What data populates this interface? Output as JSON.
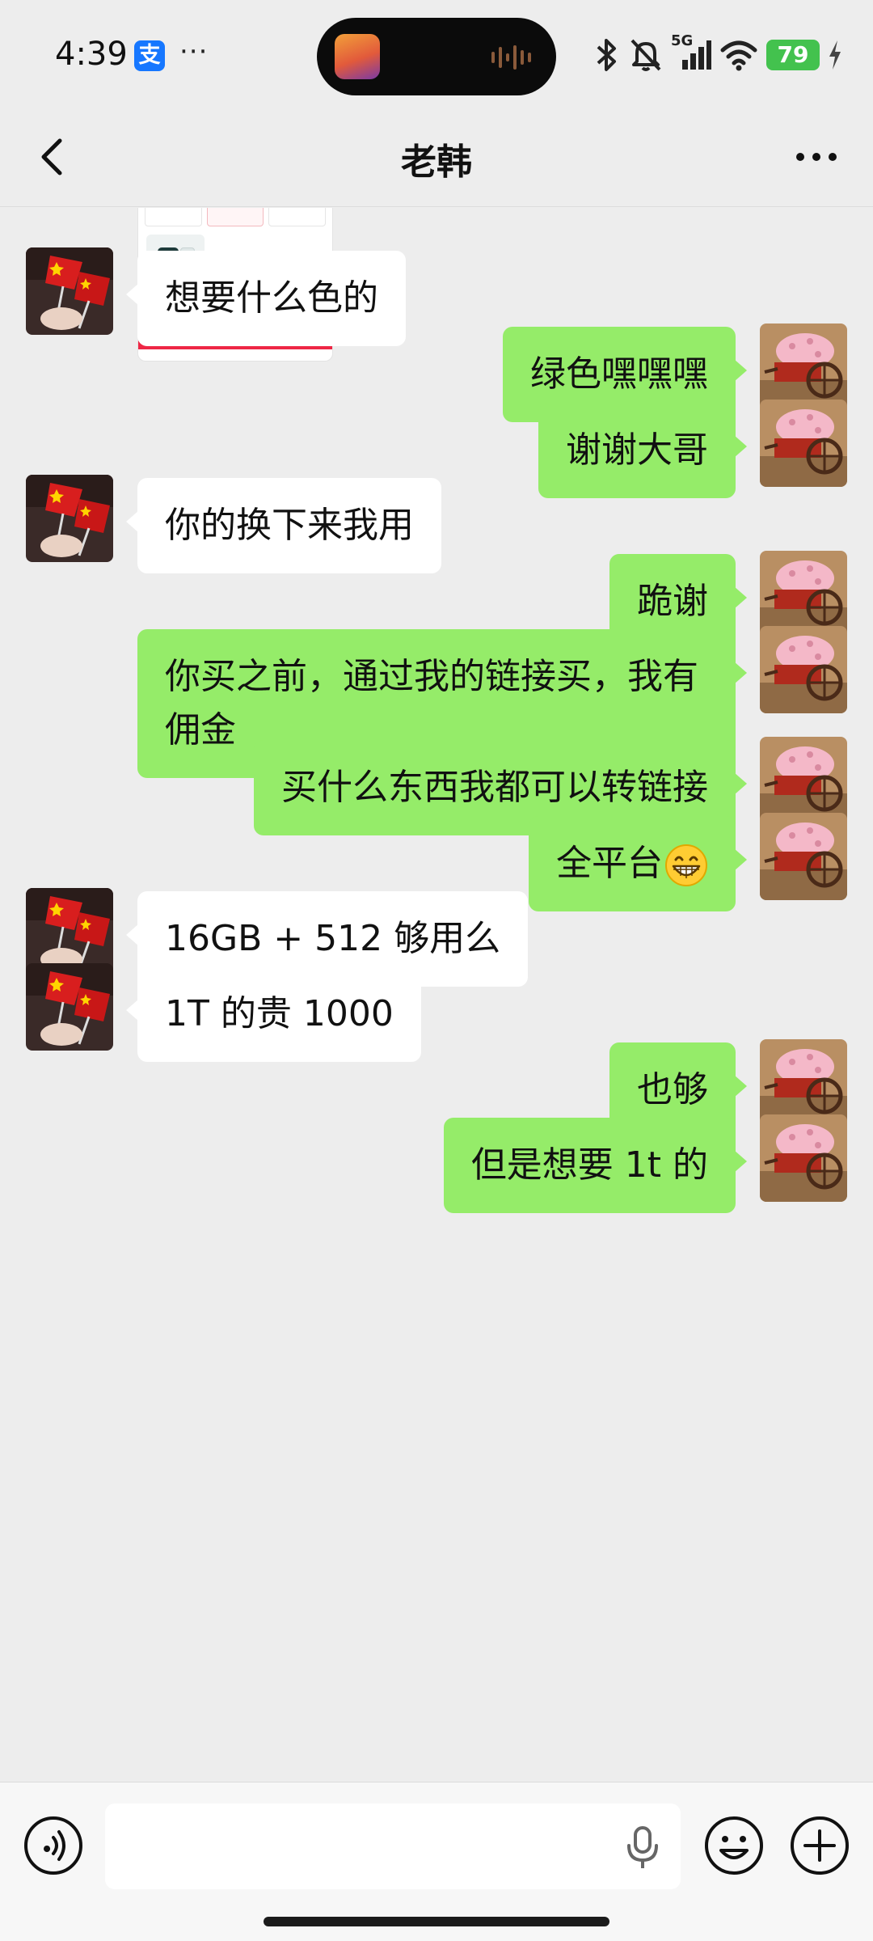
{
  "status_bar": {
    "time": "4:39",
    "alipay_glyph": "支",
    "more_dots": "···",
    "network": "5G",
    "battery": "79"
  },
  "header": {
    "title": "老韩"
  },
  "messages": [
    {
      "side": "in",
      "text": "想要什么色的"
    },
    {
      "side": "out",
      "text": "绿色嘿嘿嘿"
    },
    {
      "side": "out",
      "text": "谢谢大哥"
    },
    {
      "side": "in",
      "text": "你的换下来我用"
    },
    {
      "side": "out",
      "text": "跪谢"
    },
    {
      "side": "out",
      "text": "你买之前，通过我的链接买，我有佣金"
    },
    {
      "side": "out",
      "text": "买什么东西我都可以转链接"
    },
    {
      "side": "out",
      "text": "全平台",
      "emoji": "grinning-face-icon"
    },
    {
      "side": "in",
      "text": "16GB + 512 够用么"
    },
    {
      "side": "in",
      "text": "1T 的贵 1000"
    },
    {
      "side": "out",
      "text": "也够"
    },
    {
      "side": "out",
      "text": "但是想要 1t 的"
    }
  ],
  "icons": {
    "back": "chevron-left-icon",
    "more": "more-dots-icon",
    "voice": "voice-input-icon",
    "mic": "microphone-icon",
    "emoji": "emoji-icon",
    "plus": "plus-icon"
  },
  "colors": {
    "outgoing_bubble": "#95ec69",
    "incoming_bubble": "#ffffff",
    "background": "#ededed",
    "battery": "#43c24e"
  }
}
